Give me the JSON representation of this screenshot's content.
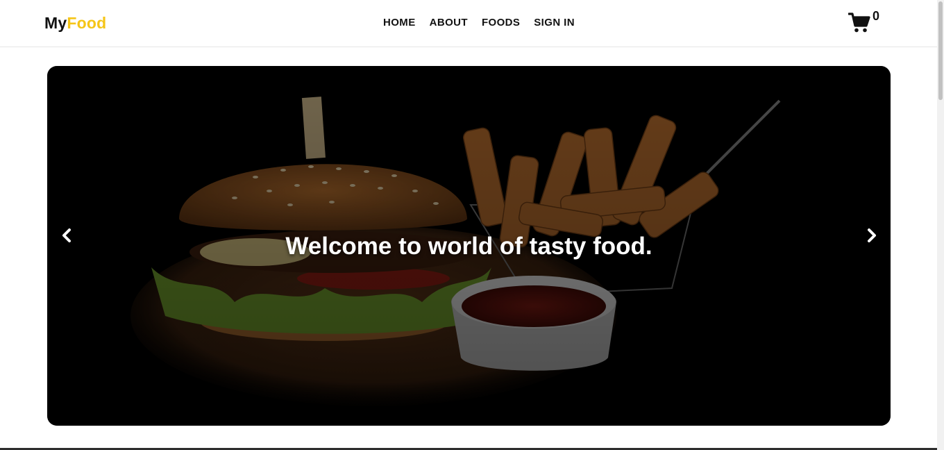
{
  "brand": {
    "part1": "My",
    "part2": "Food",
    "accent_color": "#f5c518"
  },
  "nav": {
    "items": [
      {
        "label": "HOME"
      },
      {
        "label": "ABOUT"
      },
      {
        "label": "FOODS"
      },
      {
        "label": "SIGN IN"
      }
    ]
  },
  "cart": {
    "icon": "shopping-cart-icon",
    "count": "0"
  },
  "hero": {
    "caption": "Welcome to world of tasty food.",
    "prev_icon": "chevron-left-icon",
    "next_icon": "chevron-right-icon"
  }
}
